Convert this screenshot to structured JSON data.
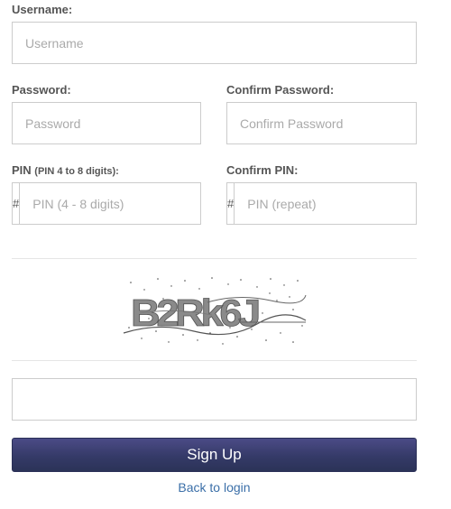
{
  "username": {
    "label": "Username:",
    "placeholder": "Username"
  },
  "password": {
    "label": "Password:",
    "placeholder": "Password"
  },
  "confirm_password": {
    "label": "Confirm Password:",
    "placeholder": "Confirm Password"
  },
  "pin": {
    "label": "PIN",
    "hint": "(PIN 4 to 8 digits):",
    "addon": "#",
    "placeholder": "PIN (4 - 8 digits)"
  },
  "confirm_pin": {
    "label": "Confirm PIN:",
    "addon": "#",
    "placeholder": "PIN (repeat)"
  },
  "captcha": {
    "text": "B2Rk6J"
  },
  "captcha_answer": {
    "value": ""
  },
  "signup_button": {
    "label": "Sign Up"
  },
  "back_link": {
    "label": "Back to login"
  }
}
